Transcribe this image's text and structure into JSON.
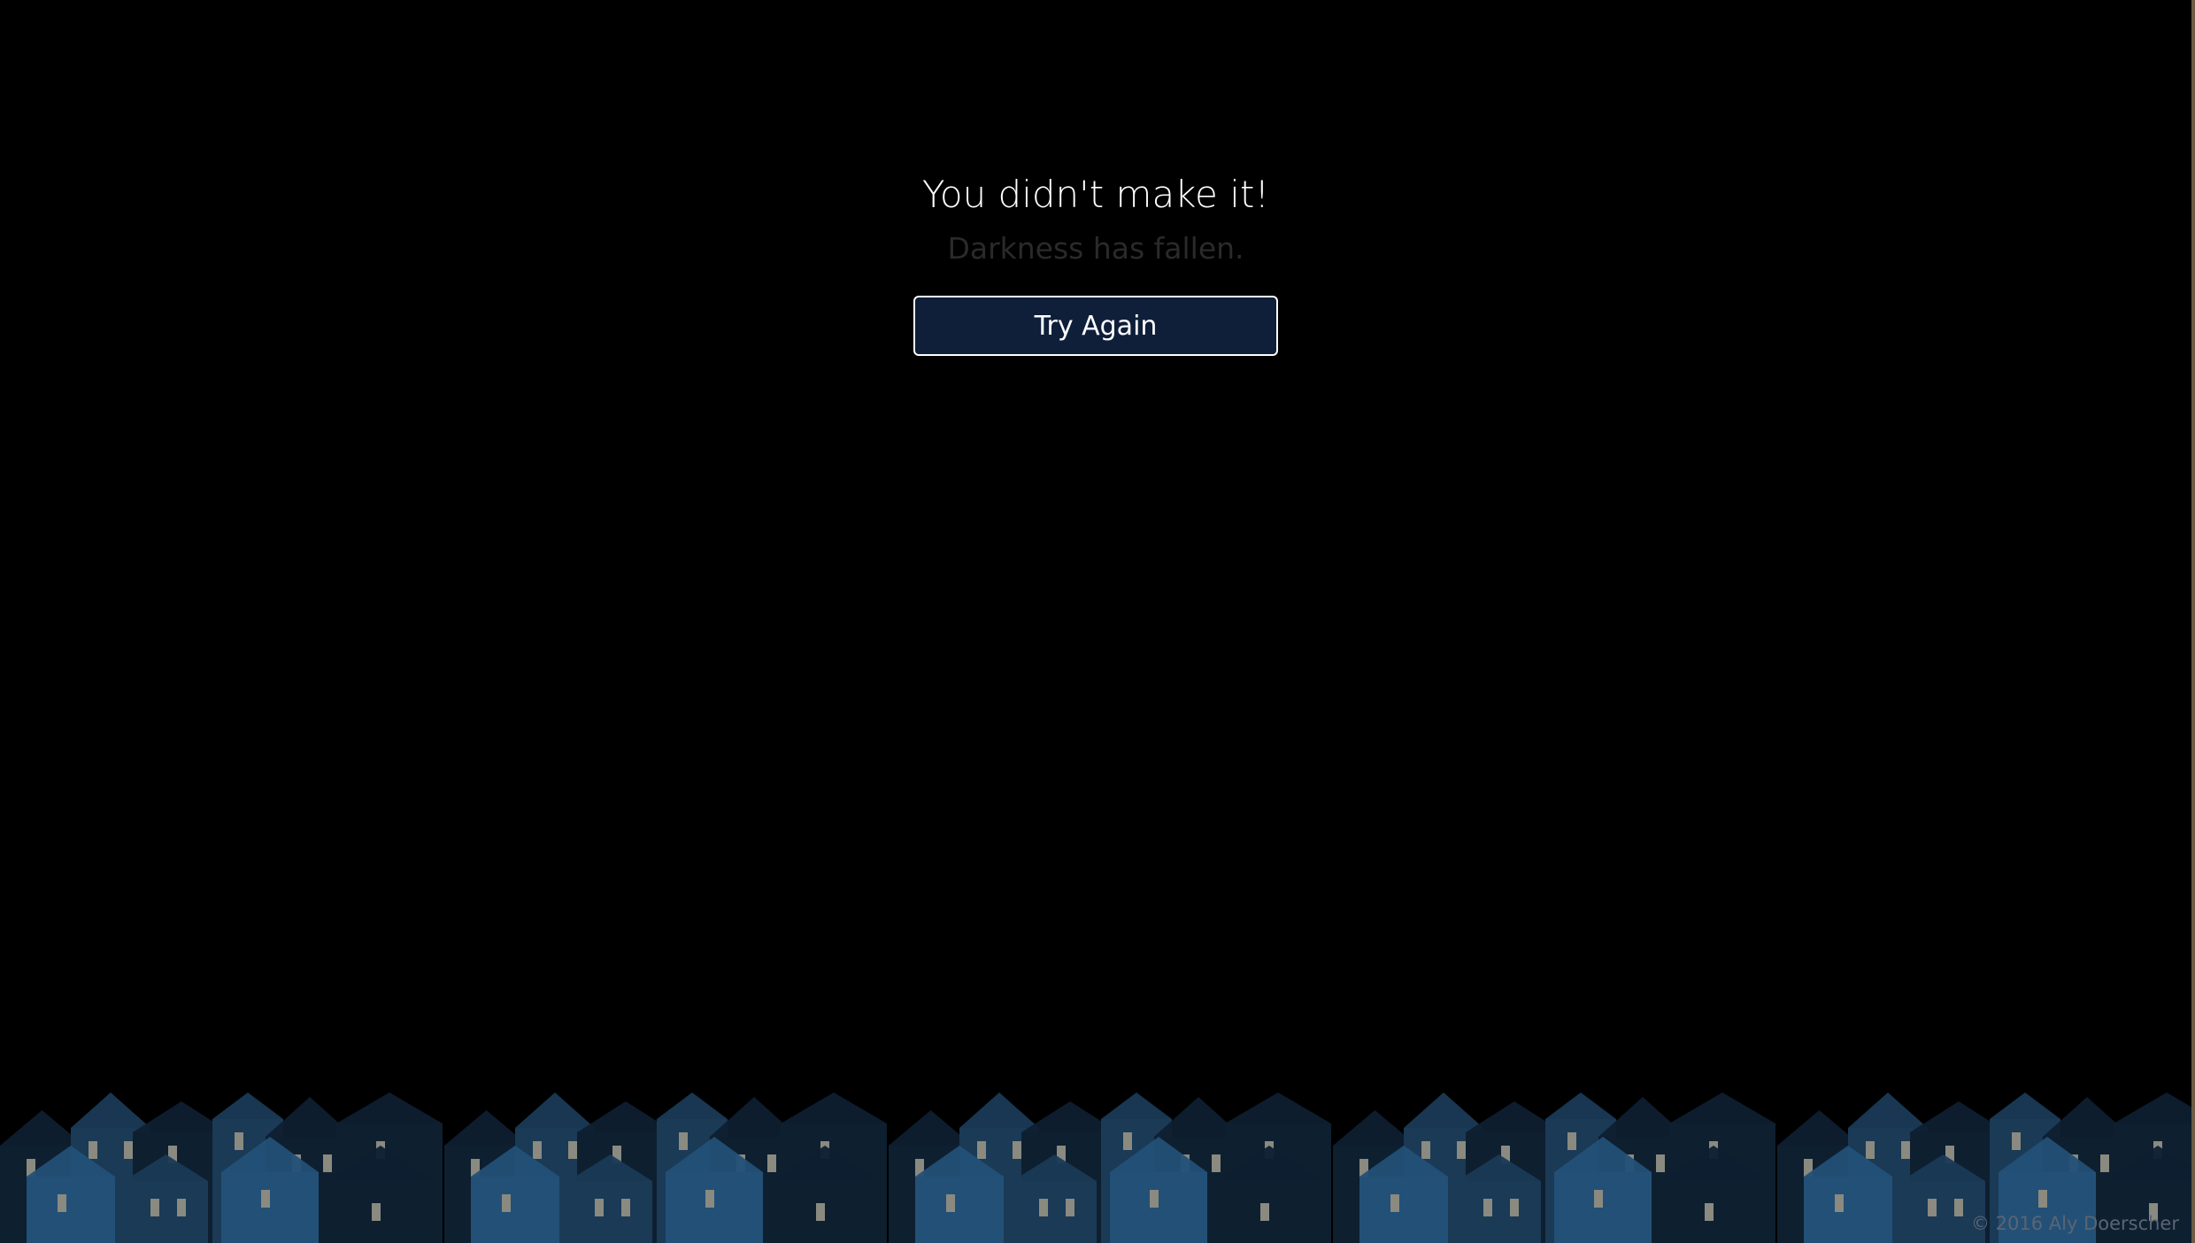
{
  "game_over": {
    "title": "You didn't make it!",
    "subtitle": "Darkness has fallen.",
    "button_label": "Try Again"
  },
  "footer": {
    "copyright": "© 2016 Aly Doerscher"
  },
  "colors": {
    "background": "#000000",
    "button_fill": "#0f1f3a",
    "button_border": "#ffffff",
    "title_text": "#ffffff",
    "subtitle_text": "#2a2a2a",
    "house_dark": "#0e1f30",
    "house_mid": "#1a3a56",
    "house_light": "#235077",
    "window_lit": "#8a8a80"
  },
  "scenery": {
    "icon": "houses-skyline-illustration"
  }
}
